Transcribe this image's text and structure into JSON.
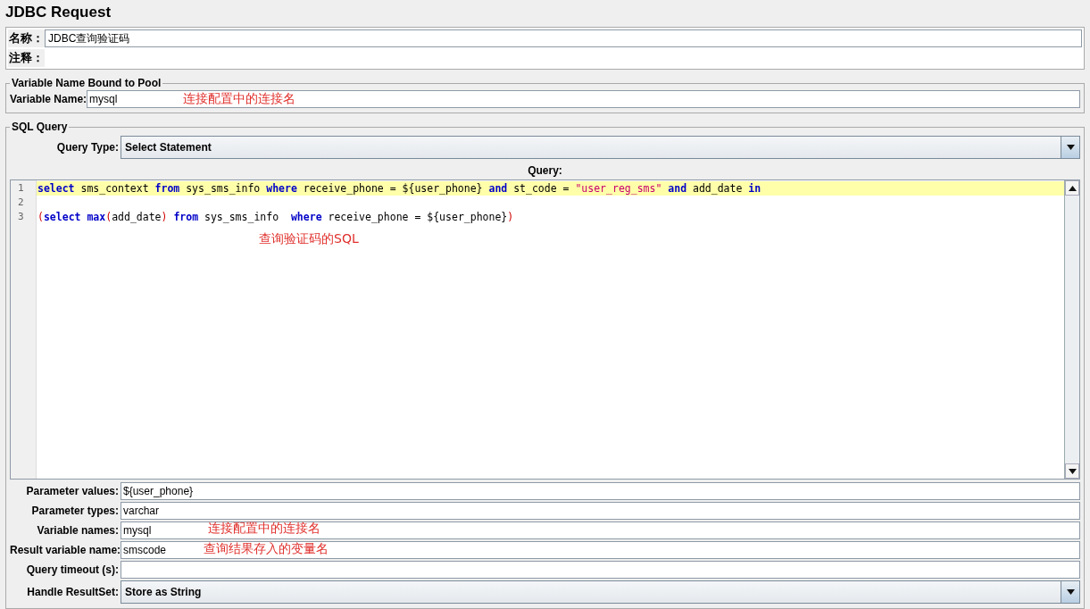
{
  "title": "JDBC Request",
  "name_panel": {
    "name_label": "名称：",
    "name_value": "JDBC查询验证码",
    "comment_label": "注释："
  },
  "pool": {
    "legend": "Variable Name Bound to Pool",
    "label": "Variable Name:",
    "value": "mysql",
    "annotation": "连接配置中的连接名"
  },
  "sql": {
    "legend": "SQL Query",
    "query_type_label": "Query Type:",
    "query_type_value": "Select Statement",
    "query_label": "Query:",
    "lines": [
      {
        "number": "1",
        "highlighted": true,
        "tokens": [
          {
            "text": "select",
            "kind": "keyword"
          },
          {
            "text": " sms_context ",
            "kind": "plain"
          },
          {
            "text": "from",
            "kind": "keyword"
          },
          {
            "text": " sys_sms_info ",
            "kind": "plain"
          },
          {
            "text": "where",
            "kind": "keyword"
          },
          {
            "text": " receive_phone = ${user_phone} ",
            "kind": "plain"
          },
          {
            "text": "and",
            "kind": "keyword"
          },
          {
            "text": " st_code = ",
            "kind": "plain"
          },
          {
            "text": "\"user_reg_sms\" ",
            "kind": "string"
          },
          {
            "text": "and",
            "kind": "keyword"
          },
          {
            "text": " add_date ",
            "kind": "plain"
          },
          {
            "text": "in",
            "kind": "keyword"
          }
        ]
      },
      {
        "number": "2",
        "highlighted": false
      },
      {
        "number": "3",
        "highlighted": false,
        "tokens": [
          {
            "text": "(",
            "kind": "paren"
          },
          {
            "text": "select ",
            "kind": "keyword"
          },
          {
            "text": "max",
            "kind": "keyword"
          },
          {
            "text": "(",
            "kind": "paren"
          },
          {
            "text": "add_date",
            "kind": "plain"
          },
          {
            "text": ") ",
            "kind": "paren"
          },
          {
            "text": "from",
            "kind": "keyword"
          },
          {
            "text": " sys_sms_info  ",
            "kind": "plain"
          },
          {
            "text": "where",
            "kind": "keyword"
          },
          {
            "text": " receive_phone = ${user_phone}",
            "kind": "plain"
          },
          {
            "text": ")",
            "kind": "paren"
          }
        ]
      }
    ],
    "editor_annotation": "查询验证码的SQL",
    "fields": [
      {
        "label": "Parameter values:",
        "value": "${user_phone}",
        "kind": "text"
      },
      {
        "label": "Parameter types:",
        "value": "varchar",
        "kind": "text"
      },
      {
        "label": "Variable names:",
        "value": "mysql",
        "kind": "text",
        "annotation": "连接配置中的连接名"
      },
      {
        "label": "Result variable name:",
        "value": "smscode",
        "kind": "text",
        "annotation": "查询结果存入的变量名"
      },
      {
        "label": "Query timeout (s):",
        "kind": "text"
      },
      {
        "label": "Handle ResultSet:",
        "value": "Store as String",
        "kind": "combo"
      }
    ]
  }
}
